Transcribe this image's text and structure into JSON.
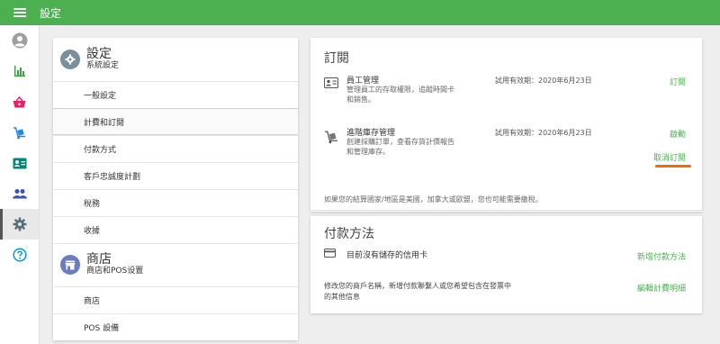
{
  "app": {
    "title": "設定"
  },
  "colors": {
    "primary": "#4caf50",
    "accent_underline": "#ef6c00",
    "indigo": "#6b7cc1"
  },
  "siderail": {
    "items": [
      {
        "icon": "account-circle-icon",
        "active": false
      },
      {
        "icon": "bar-chart-icon",
        "active": false
      },
      {
        "icon": "shopping-basket-icon",
        "active": false
      },
      {
        "icon": "dolly-icon",
        "active": false
      },
      {
        "icon": "id-card-icon",
        "active": false
      },
      {
        "icon": "people-icon",
        "active": false
      },
      {
        "icon": "gear-icon",
        "active": true
      },
      {
        "icon": "help-icon",
        "active": false
      }
    ]
  },
  "settings_nav": {
    "system": {
      "title": "設定",
      "subtitle": "系統設定",
      "items": [
        "一般設定",
        "計費和訂閱",
        "付款方式",
        "客戶忠誠度計劃",
        "稅務",
        "收據"
      ]
    },
    "store": {
      "title": "商店",
      "subtitle": "商店和POS设置",
      "items": [
        "商店",
        "POS 設備"
      ]
    }
  },
  "subscriptions": {
    "title": "訂閱",
    "items": [
      {
        "name": "員工管理",
        "description": "管理員工的存取權限，追蹤時間卡和銷售。",
        "trial": "試用有效期：2020年6月23日",
        "action": "訂閱"
      },
      {
        "name": "進階庫存管理",
        "description": "創建採購訂單，查看存貨計價報告和管理庫存。",
        "trial": "試用有效期：2020年6月23日",
        "action": "啟動",
        "secondary_action": "取消訂閱"
      }
    ],
    "note": "如果您的結算國家/地區是美國，加拿大或歐盟，您也可能需要繳稅。"
  },
  "payment": {
    "title": "付款方法",
    "no_card": "目前沒有儲存的信用卡",
    "add_action": "新增付款方法",
    "info": "修改您的商戶名稱，新增付款聯繫人或您希望包含在發票中的其他信息",
    "edit_action": "編輯計費明細"
  }
}
